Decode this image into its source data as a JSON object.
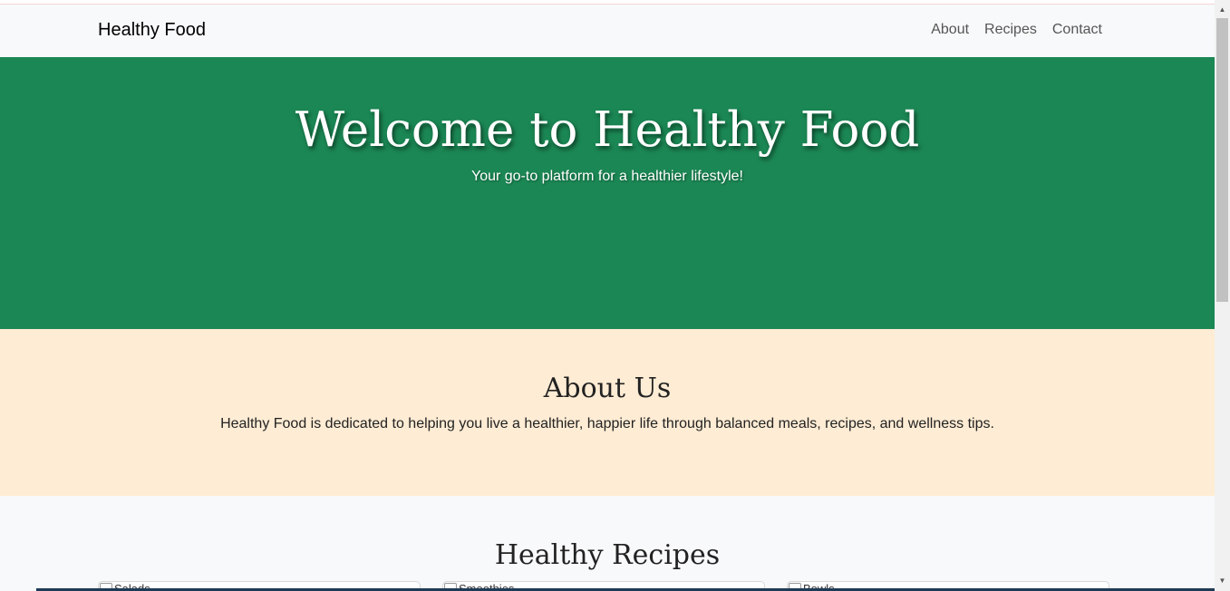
{
  "navbar": {
    "brand": "Healthy Food",
    "links": [
      "About",
      "Recipes",
      "Contact"
    ]
  },
  "hero": {
    "title": "Welcome to Healthy Food",
    "subtitle": "Your go-to platform for a healthier lifestyle!"
  },
  "about": {
    "title": "About Us",
    "text": "Healthy Food is dedicated to helping you live a healthier, happier life through balanced meals, recipes, and wellness tips."
  },
  "recipes": {
    "title": "Healthy Recipes",
    "cards": [
      {
        "img_alt": "Salads"
      },
      {
        "img_alt": "Smoothies"
      },
      {
        "img_alt": "Bowls"
      }
    ]
  },
  "colors": {
    "hero_bg": "#1b8754",
    "about_bg": "#ffecd4",
    "page_bg": "#f8f9fa"
  }
}
